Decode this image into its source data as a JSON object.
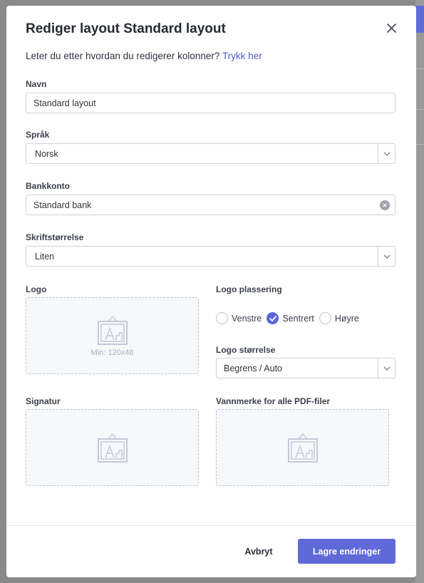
{
  "dialog": {
    "title": "Rediger layout Standard layout",
    "help_text": "Leter du etter hvordan du redigerer kolonner? ",
    "help_link": "Trykk her"
  },
  "fields": {
    "name": {
      "label": "Navn",
      "value": "Standard layout"
    },
    "language": {
      "label": "Språk",
      "value": "Norsk"
    },
    "bank_account": {
      "label": "Bankkonto",
      "value": "Standard bank"
    },
    "font_size": {
      "label": "Skriftstørrelse",
      "value": "Liten"
    }
  },
  "logo": {
    "label": "Logo",
    "hint": "Min: 120x48"
  },
  "logo_position": {
    "label": "Logo plassering",
    "options": [
      "Venstre",
      "Sentrert",
      "Høyre"
    ],
    "selected": "Sentrert"
  },
  "logo_size": {
    "label": "Logo størrelse",
    "value": "Begrens / Auto"
  },
  "signature": {
    "label": "Signatur"
  },
  "watermark": {
    "label": "Vannmerke for alle PDF-filer"
  },
  "footer": {
    "cancel_label": "Avbryt",
    "save_label": "Lagre endringer"
  },
  "colors": {
    "accent": "#5f69d8",
    "border": "#cfd3da",
    "dropzone_border": "#b9c0d4"
  },
  "icons": [
    "close-icon",
    "chevron-down-icon",
    "clear-icon",
    "image-placeholder-icon",
    "check-icon"
  ]
}
